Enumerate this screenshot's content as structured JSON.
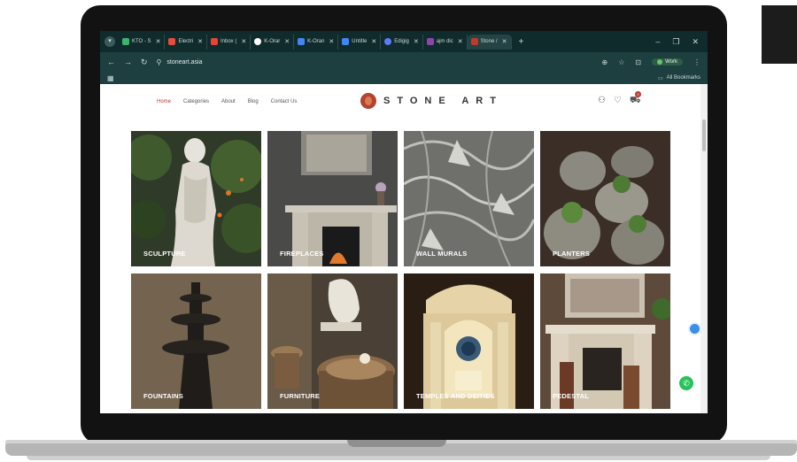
{
  "browser": {
    "tabs": [
      {
        "label": "KTO - S",
        "color": "#3cb371",
        "active": false
      },
      {
        "label": "Electri",
        "color": "#e74c3c",
        "active": false
      },
      {
        "label": "Inbox (",
        "color": "#ea4335",
        "active": false
      },
      {
        "label": "K-Orar",
        "color": "#ffffff",
        "active": false
      },
      {
        "label": "K-Oran",
        "color": "#4285f4",
        "active": false
      },
      {
        "label": "Untitle",
        "color": "#4285f4",
        "active": false
      },
      {
        "label": "Edigig",
        "color": "#5b7cfa",
        "active": false
      },
      {
        "label": "ajm dic",
        "color": "#8e44ad",
        "active": false
      },
      {
        "label": "Stone /",
        "color": "#c0392b",
        "active": true
      }
    ],
    "url": "stoneart.asia",
    "profile_label": "Work",
    "bookmarks_label": "All Bookmarks"
  },
  "site": {
    "menu": [
      "Home",
      "Categories",
      "About",
      "Blog",
      "Contact Us"
    ],
    "logo_text": "STONE ART",
    "cart_count": "0",
    "categories": [
      {
        "label": "SCULPTURE"
      },
      {
        "label": "FIREPLACES"
      },
      {
        "label": "WALL MURALS"
      },
      {
        "label": "PLANTERS"
      },
      {
        "label": "FOUNTAINS"
      },
      {
        "label": "FURNITURE"
      },
      {
        "label": "TEMPLES AND DEITIES"
      },
      {
        "label": "PEDESTAL"
      }
    ]
  },
  "colors": {
    "tab_bar": "#0f2b2c",
    "address_bar": "#1d3f40",
    "accent": "#c0392b",
    "whatsapp": "#25c35a"
  }
}
